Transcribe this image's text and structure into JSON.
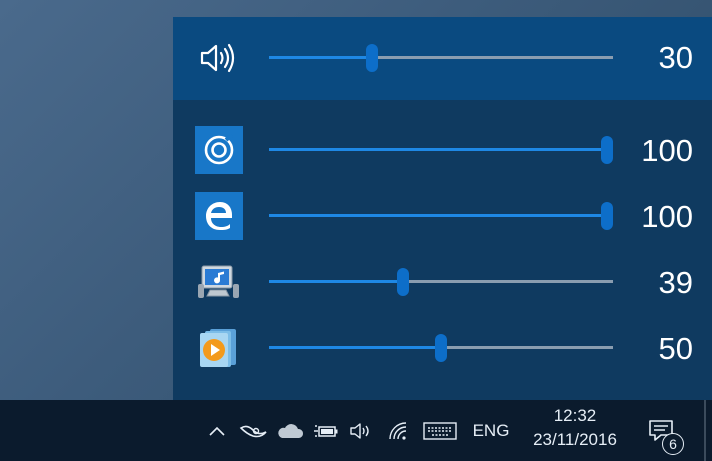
{
  "master": {
    "icon": "speaker-icon",
    "value": "30",
    "level": 30
  },
  "apps": [
    {
      "icon": "groove-music-icon",
      "value": "100",
      "level": 100
    },
    {
      "icon": "edge-icon",
      "value": "100",
      "level": 100
    },
    {
      "icon": "system-sounds-icon",
      "value": "39",
      "level": 39
    },
    {
      "icon": "windows-media-player-icon",
      "value": "50",
      "level": 50
    }
  ],
  "taskbar": {
    "language": "ENG",
    "time": "12:32",
    "date": "23/11/2016",
    "notification_count": "6"
  },
  "colors": {
    "accent": "#1e88e5",
    "thumb": "#0d6ec9",
    "flyout_bg": "#0f3a60",
    "master_bg": "#0a4a80",
    "taskbar_bg": "#0b1b2d"
  }
}
